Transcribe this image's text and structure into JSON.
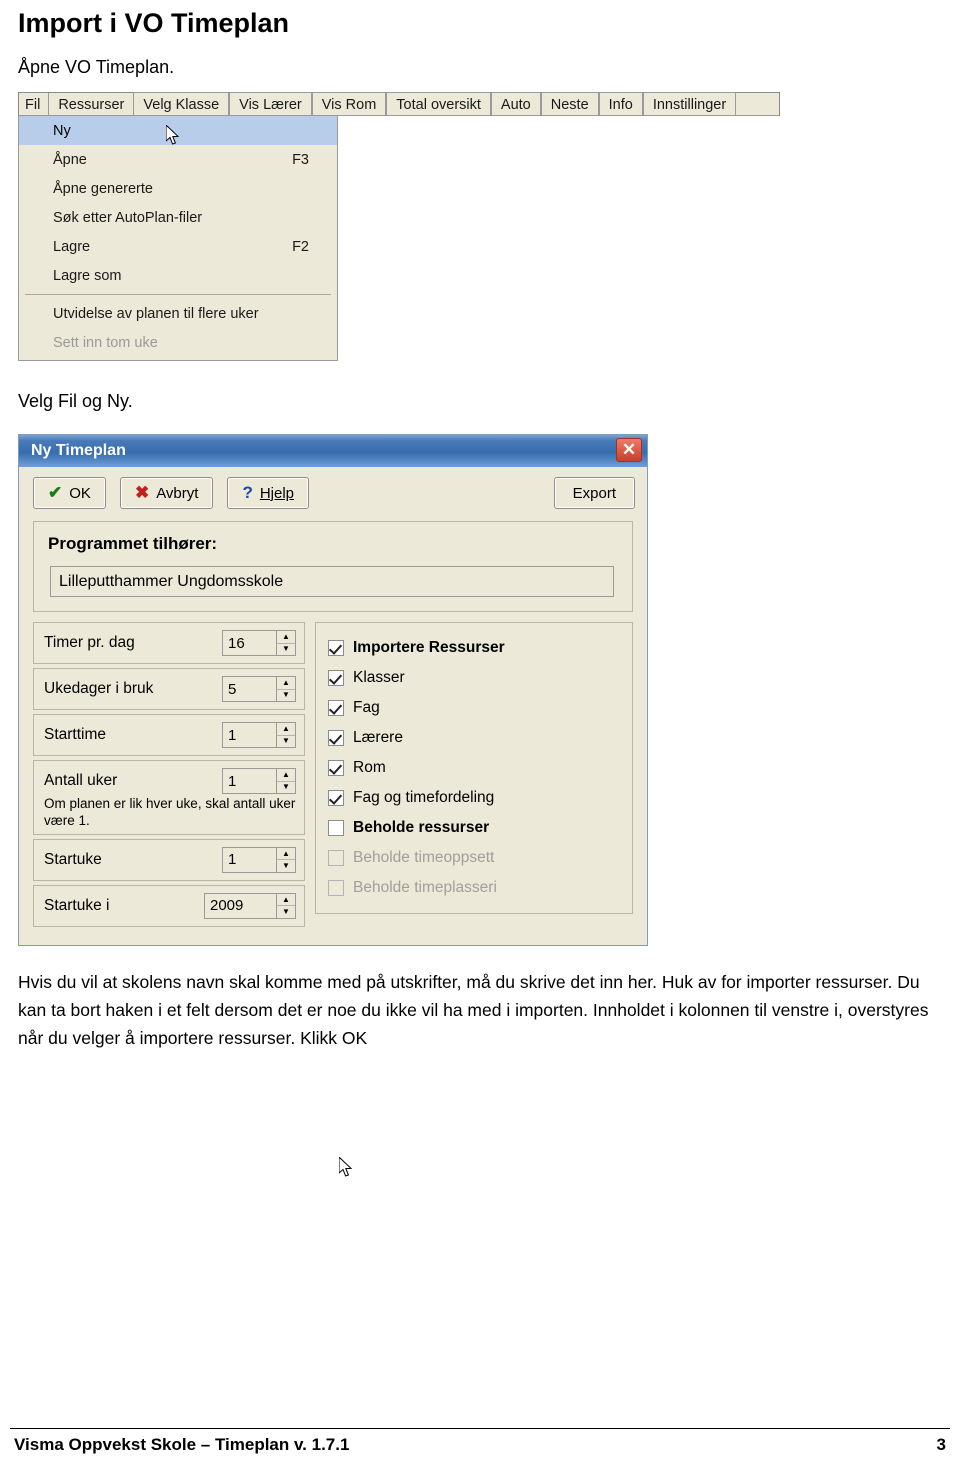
{
  "document": {
    "title": "Import  i VO Timeplan",
    "subtitle": "Åpne VO Timeplan.",
    "step_caption": "Velg Fil og Ny.",
    "paragraph": "Hvis du vil at skolens navn skal komme med på utskrifter, må du skrive det inn her. Huk av for importer ressurser. Du kan ta bort haken i et felt dersom det er noe du ikke vil ha med i importen. Innholdet i kolonnen til venstre i, overstyres når du velger å importere ressurser. Klikk OK"
  },
  "menu_screenshot": {
    "menubar": [
      "Fil",
      "Ressurser",
      "Velg Klasse",
      "Vis Lærer",
      "Vis Rom",
      "Total oversikt",
      "Auto",
      "Neste",
      "Info",
      "Innstillinger"
    ],
    "dropdown": [
      {
        "label": "Ny",
        "shortcut": "",
        "selected": true,
        "dim": false
      },
      {
        "label": "Åpne",
        "shortcut": "F3",
        "selected": false,
        "dim": false
      },
      {
        "label": "Åpne genererte",
        "shortcut": "",
        "selected": false,
        "dim": false
      },
      {
        "label": "Søk etter AutoPlan-filer",
        "shortcut": "",
        "selected": false,
        "dim": false
      },
      {
        "label": "Lagre",
        "shortcut": "F2",
        "selected": false,
        "dim": false
      },
      {
        "label": "Lagre som",
        "shortcut": "",
        "selected": false,
        "dim": false
      },
      {
        "label": "Utvidelse av planen til flere uker",
        "shortcut": "",
        "selected": false,
        "dim": false
      },
      {
        "label": "Sett inn tom uke",
        "shortcut": "",
        "selected": false,
        "dim": true
      }
    ]
  },
  "dialog": {
    "title": "Ny Timeplan",
    "close_label": "✕",
    "buttons": {
      "ok": "OK",
      "cancel": "Avbryt",
      "help": "Hjelp",
      "export": "Export"
    },
    "owner_panel": {
      "label": "Programmet tilhører:",
      "value": "Lilleputthammer Ungdomsskole"
    },
    "fields": [
      {
        "label": "Timer pr. dag",
        "value": "16",
        "note": ""
      },
      {
        "label": "Ukedager i bruk",
        "value": "5",
        "note": ""
      },
      {
        "label": "Starttime",
        "value": "1",
        "note": ""
      },
      {
        "label": "Antall uker",
        "value": "1",
        "note": "Om planen er lik hver uke, skal antall uker være 1."
      },
      {
        "label": "Startuke",
        "value": "1",
        "note": ""
      },
      {
        "label": "Startuke i",
        "value": "2009",
        "note": ""
      }
    ],
    "checkboxes": [
      {
        "label": "Importere Ressurser",
        "checked": true,
        "disabled": false,
        "bold": true
      },
      {
        "label": "Klasser",
        "checked": true,
        "disabled": false,
        "bold": false
      },
      {
        "label": "Fag",
        "checked": true,
        "disabled": false,
        "bold": false
      },
      {
        "label": "Lærere",
        "checked": true,
        "disabled": false,
        "bold": false
      },
      {
        "label": "Rom",
        "checked": true,
        "disabled": false,
        "bold": false
      },
      {
        "label": "Fag og timefordeling",
        "checked": true,
        "disabled": false,
        "bold": false
      },
      {
        "label": "Beholde ressurser",
        "checked": false,
        "disabled": false,
        "bold": true
      },
      {
        "label": "Beholde timeoppsett",
        "checked": false,
        "disabled": true,
        "bold": false
      },
      {
        "label": "Beholde timeplasseri",
        "checked": false,
        "disabled": true,
        "bold": false
      }
    ]
  },
  "footer": {
    "left": "Visma Oppvekst Skole – Timeplan v. 1.7.1",
    "page": "3"
  }
}
